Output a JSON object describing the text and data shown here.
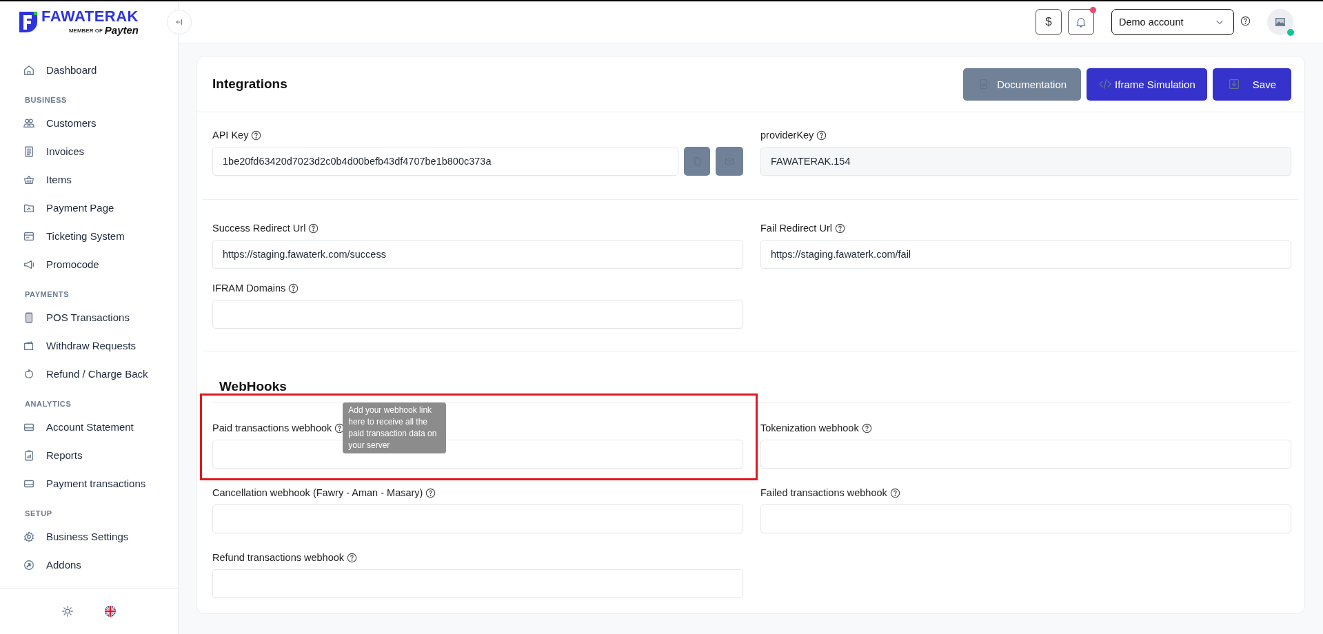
{
  "brand": {
    "name": "FAWATERAK",
    "tagline_prefix": "MEMBER OF",
    "tagline_brand": "Payten"
  },
  "sidebar": {
    "sections": [
      {
        "items": [
          {
            "label": "Dashboard"
          }
        ]
      },
      {
        "title": "BUSINESS",
        "items": [
          {
            "label": "Customers"
          },
          {
            "label": "Invoices"
          },
          {
            "label": "Items"
          },
          {
            "label": "Payment Page"
          },
          {
            "label": "Ticketing System"
          },
          {
            "label": "Promocode"
          }
        ]
      },
      {
        "title": "PAYMENTS",
        "items": [
          {
            "label": "POS Transactions"
          },
          {
            "label": "Withdraw Requests"
          },
          {
            "label": "Refund / Charge Back"
          }
        ]
      },
      {
        "title": "ANALYTICS",
        "items": [
          {
            "label": "Account Statement"
          },
          {
            "label": "Reports"
          },
          {
            "label": "Payment transactions"
          }
        ]
      },
      {
        "title": "SETUP",
        "items": [
          {
            "label": "Business Settings"
          },
          {
            "label": "Addons"
          }
        ]
      }
    ]
  },
  "header": {
    "currency_button": "$",
    "notification_badge": true,
    "account_select": "Demo account",
    "avatar_online": true
  },
  "page": {
    "title": "Integrations",
    "buttons": [
      {
        "label": "Documentation",
        "kind": "secondary"
      },
      {
        "label": "Iframe Simulation",
        "kind": "code"
      },
      {
        "label": "Save",
        "kind": "save"
      }
    ],
    "sections": [
      {
        "rows": [
          [
            {
              "label": "API Key",
              "value": "1be20fd63420d7023d2c0b4d00befb43df4707be1b800c373a",
              "kind": "key"
            },
            {
              "label": "providerKey",
              "value": "FAWATERAK.154",
              "kind": "readonly"
            }
          ]
        ]
      },
      {
        "rows": [
          [
            {
              "label": "Success Redirect Url",
              "value": "https://staging.fawaterk.com/success",
              "kind": "text"
            },
            {
              "label": "Fail Redirect Url",
              "value": "https://staging.fawaterk.com/fail",
              "kind": "text"
            }
          ],
          [
            {
              "label": "IFRAM Domains",
              "kind": "text"
            }
          ]
        ]
      },
      {
        "title": "WebHooks",
        "rows": [
          [
            {
              "label": "Paid transactions webhook",
              "kind": "text",
              "highlighted": true,
              "tooltip": "Add your webhook link here to receive all the paid transaction data on your server"
            },
            {
              "label": "Tokenization webhook",
              "kind": "text"
            }
          ],
          [
            {
              "label": "Cancellation webhook (Fawry - Aman - Masary)",
              "kind": "text"
            },
            {
              "label": "Failed transactions webhook",
              "kind": "text"
            }
          ],
          [
            {
              "label": "Refund transactions webhook",
              "kind": "text"
            }
          ]
        ]
      }
    ]
  }
}
